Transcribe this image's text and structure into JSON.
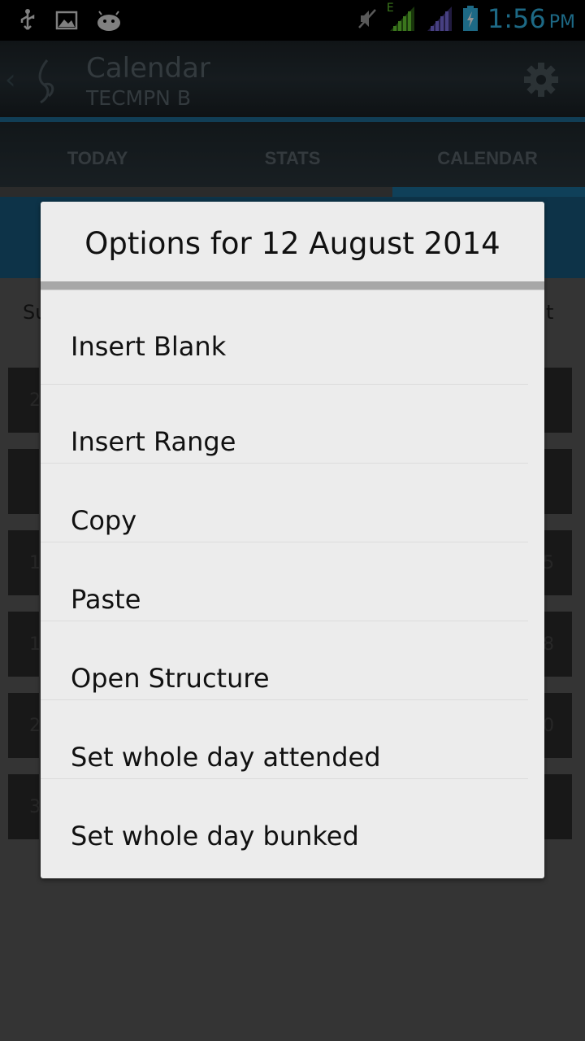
{
  "status_bar": {
    "time": "1:56",
    "ampm": "PM",
    "network_label": "E",
    "icons": [
      "usb-icon",
      "image-icon",
      "android-icon",
      "mute-icon",
      "signal-icon",
      "signal-icon-2",
      "battery-charging-icon"
    ]
  },
  "action_bar": {
    "title": "Calendar",
    "subtitle": "TECMPN B"
  },
  "tabs": [
    {
      "label": "TODAY"
    },
    {
      "label": "STATS"
    },
    {
      "label": "CALENDAR"
    }
  ],
  "background": {
    "day_header_left": "Su",
    "day_header_right": "t",
    "numbers_left": [
      "2",
      "",
      "1",
      "1",
      "2",
      "3"
    ],
    "numbers_right": [
      "",
      "",
      "5",
      "8",
      "0",
      ""
    ]
  },
  "dialog": {
    "title": "Options for 12 August 2014",
    "items": [
      {
        "label": "Insert Blank"
      },
      {
        "label": "Insert Range"
      },
      {
        "label": "Copy"
      },
      {
        "label": "Paste"
      },
      {
        "label": "Open Structure"
      },
      {
        "label": "Set whole day attended"
      },
      {
        "label": "Set whole day bunked"
      }
    ]
  },
  "colors": {
    "accent": "#33b5e5",
    "tab_indicator": "#1a6f9a",
    "dialog_bg": "#ececec"
  }
}
